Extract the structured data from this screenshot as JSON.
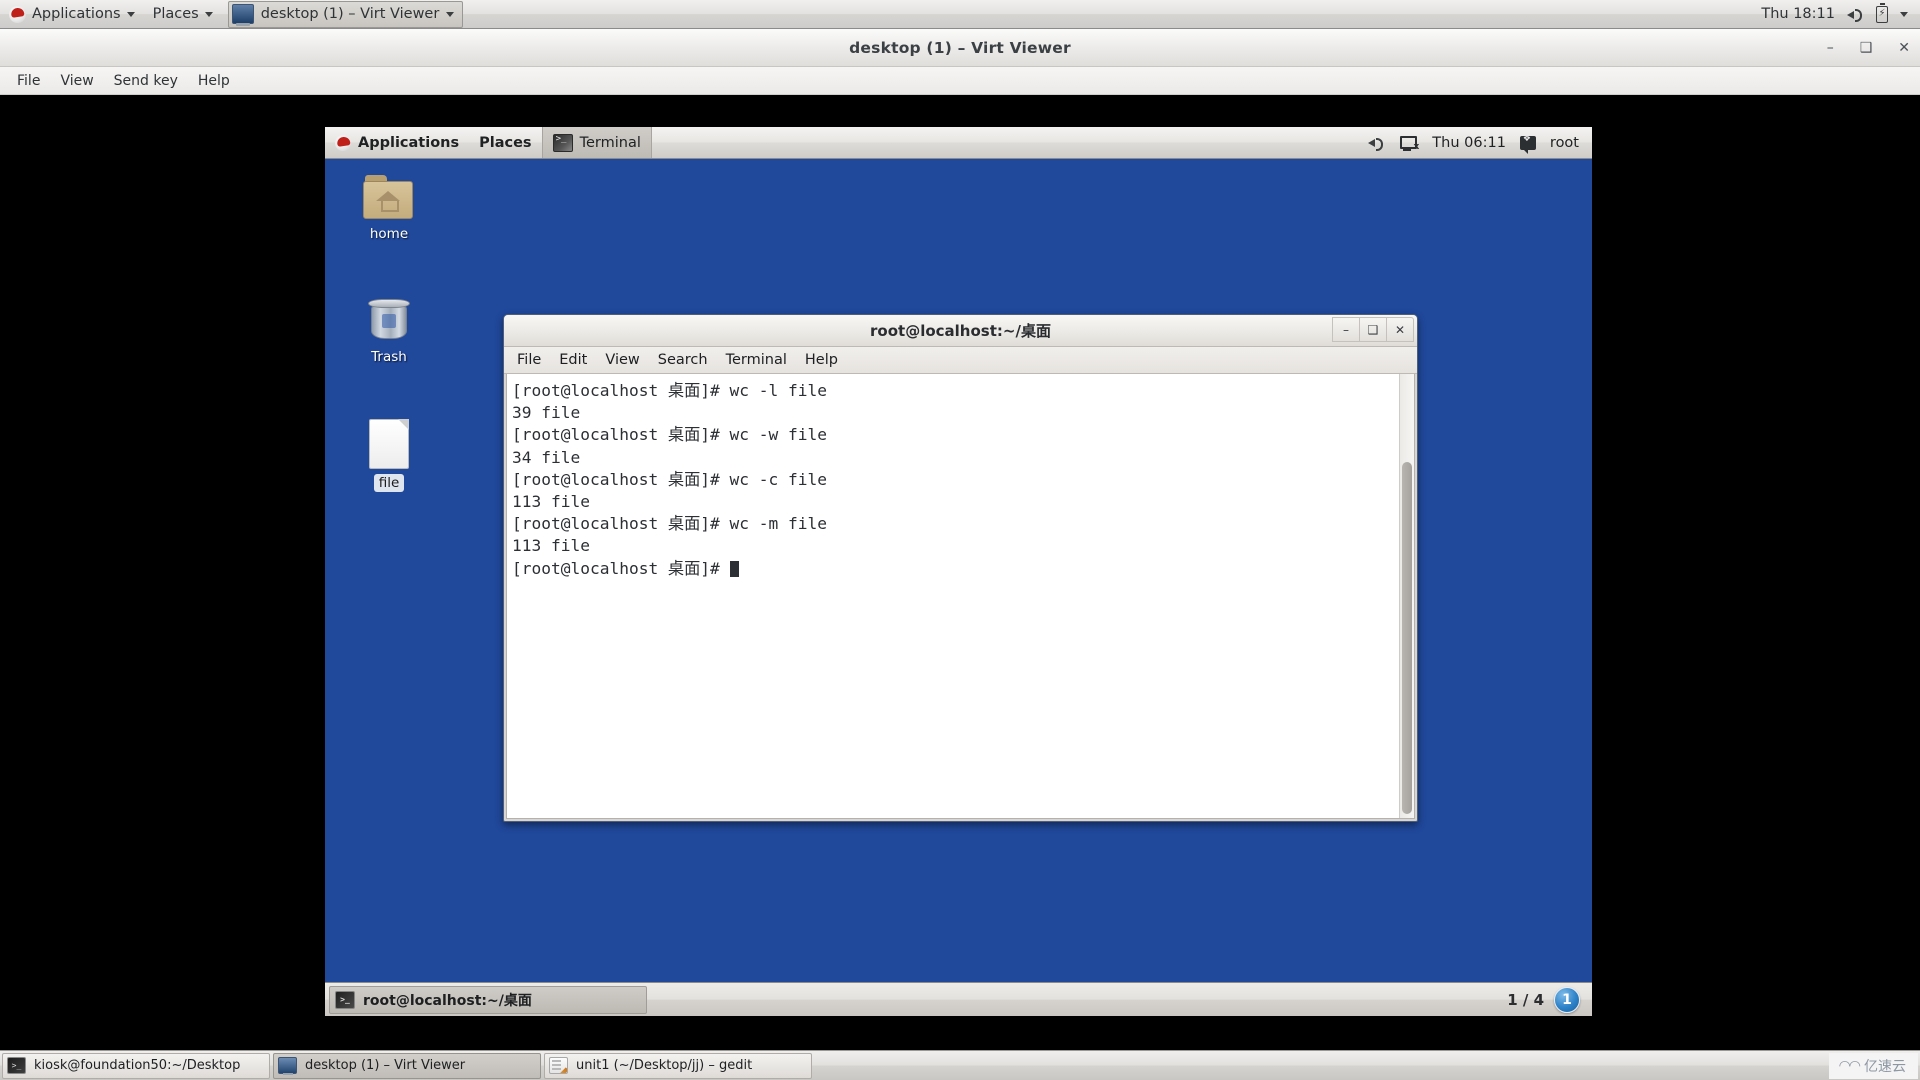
{
  "host_panel": {
    "applications_label": "Applications",
    "places_label": "Places",
    "window_button_label": "desktop (1) – Virt Viewer",
    "clock": "Thu 18:11",
    "icons": [
      "redhat-icon",
      "volume-icon",
      "battery-icon",
      "chevron-down-icon"
    ]
  },
  "virt_viewer": {
    "title": "desktop (1) – Virt Viewer",
    "window_controls": {
      "minimize": "–",
      "maximize": "❑",
      "close": "✕"
    },
    "menu": [
      "File",
      "View",
      "Send key",
      "Help"
    ]
  },
  "guest": {
    "panel": {
      "applications_label": "Applications",
      "places_label": "Places",
      "active_app_label": "Terminal",
      "clock": "Thu 06:11",
      "user": "root",
      "icons": [
        "redhat-icon",
        "terminal-icon",
        "volume-icon",
        "network-disconnected-icon",
        "user-icon"
      ]
    },
    "desktop_icons": [
      {
        "name": "home",
        "label": "home",
        "icon": "home-folder-icon",
        "selected": false
      },
      {
        "name": "trash",
        "label": "Trash",
        "icon": "trash-icon",
        "selected": false
      },
      {
        "name": "file",
        "label": "file",
        "icon": "text-file-icon",
        "selected": true
      }
    ],
    "taskbar": {
      "window_button_label": "root@localhost:~/桌面",
      "workspace_indicator": "1 / 4",
      "workspace_badge": "1"
    }
  },
  "terminal": {
    "title": "root@localhost:~/桌面",
    "window_controls": {
      "minimize": "–",
      "maximize": "❑",
      "close": "✕"
    },
    "menu": [
      "File",
      "Edit",
      "View",
      "Search",
      "Terminal",
      "Help"
    ],
    "lines": [
      "[root@localhost 桌面]# wc -l file",
      "39 file",
      "[root@localhost 桌面]# wc -w file",
      "34 file",
      "[root@localhost 桌面]# wc -c file",
      "113 file",
      "[root@localhost 桌面]# wc -m file",
      "113 file"
    ],
    "prompt": "[root@localhost 桌面]# "
  },
  "host_taskbar": {
    "buttons": [
      {
        "label": "kiosk@foundation50:~/Desktop",
        "icon": "terminal-icon",
        "active": false
      },
      {
        "label": "desktop (1) – Virt Viewer",
        "icon": "virt-viewer-icon",
        "active": true
      },
      {
        "label": "unit1 (~/Desktop/jj) – gedit",
        "icon": "gedit-icon",
        "active": false
      }
    ],
    "watermark": "亿速云"
  },
  "colors": {
    "desktop_blue": "#20489b",
    "panel_gray": "#e4e2e0",
    "terminal_bg": "#ffffff",
    "terminal_fg": "#2c2f33",
    "accent_blue": "#2d82c8"
  }
}
